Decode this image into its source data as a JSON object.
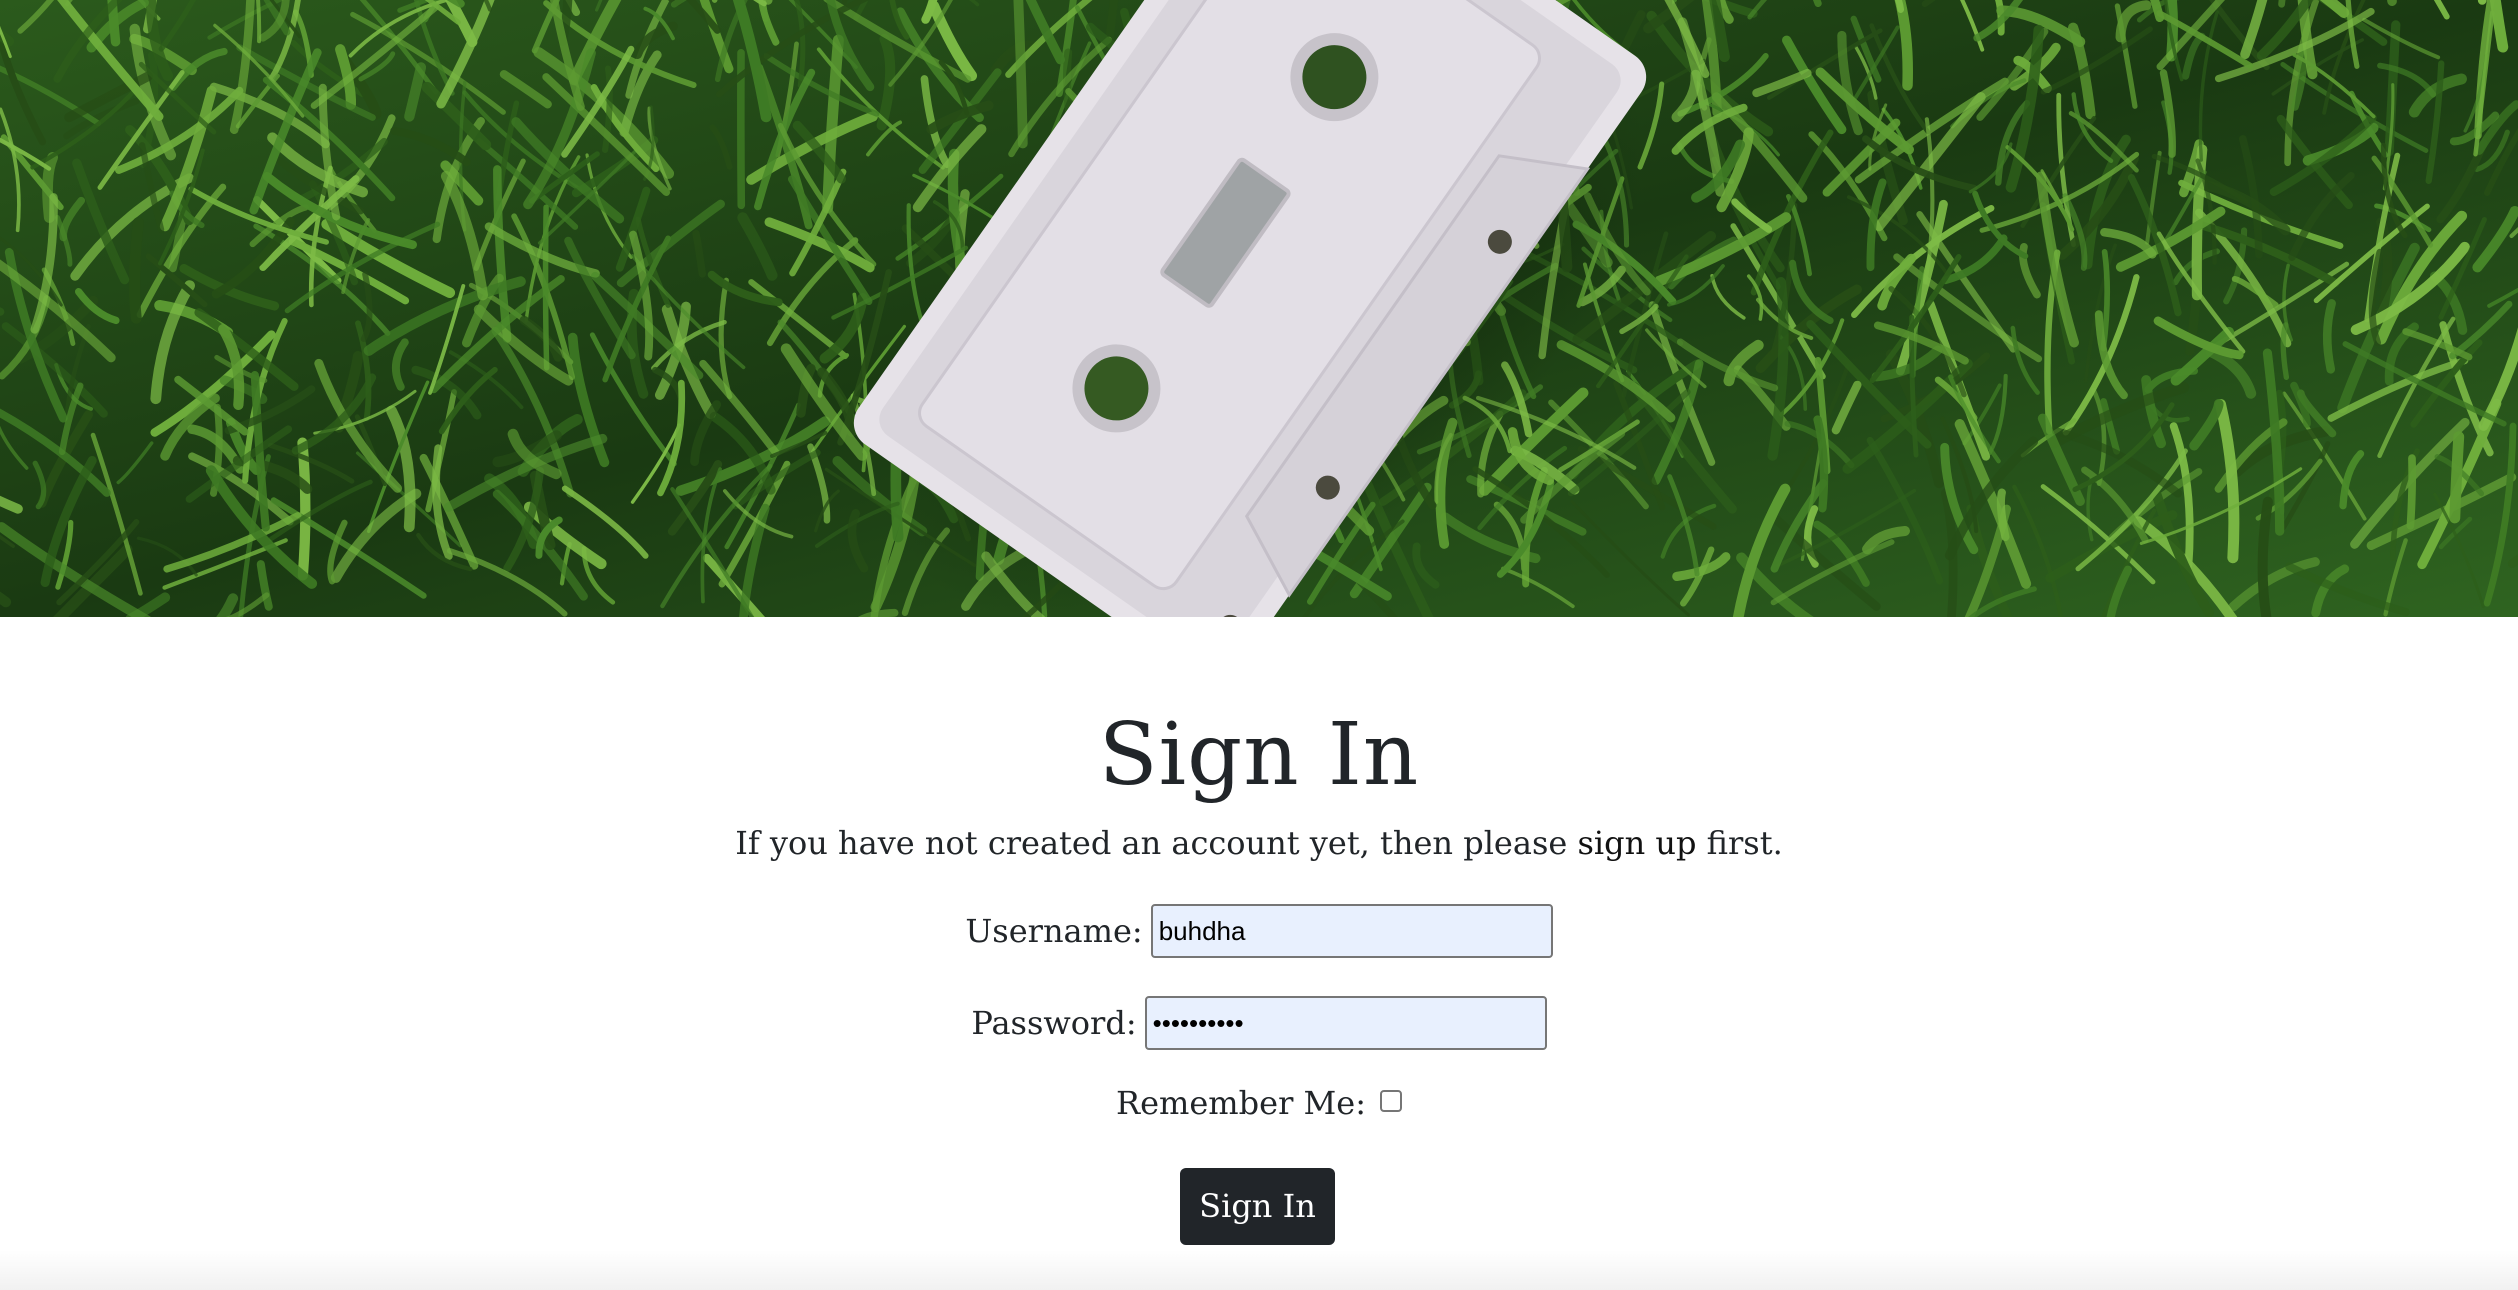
{
  "hero": {
    "image": "cassette-tape-on-grass-banner"
  },
  "signin": {
    "title": "Sign In",
    "intro_before": "If you have not created an account yet, then please ",
    "signup_link": "sign up",
    "intro_after": " first.",
    "username_label": "Username:",
    "username_value": "buhdha",
    "password_label": "Password:",
    "password_value": "••••••••••",
    "remember_label": "Remember Me:",
    "remember_checked": false,
    "submit_label": "Sign In"
  },
  "colors": {
    "button_bg": "#212529",
    "input_autofill_bg": "#e8f0fe",
    "grass_dark": "#1d3a16",
    "grass_light": "#5c9a32"
  }
}
